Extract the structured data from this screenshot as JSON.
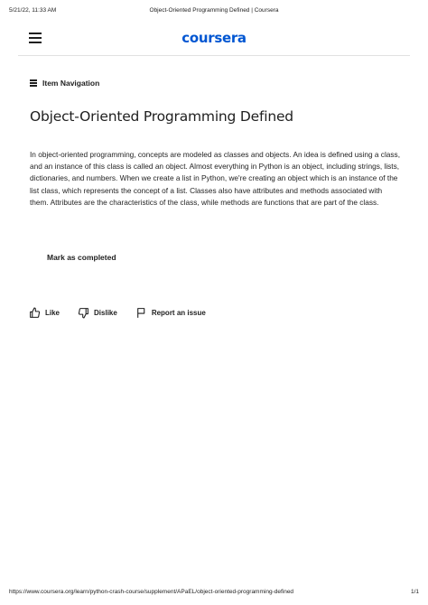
{
  "print_header": {
    "datetime": "5/21/22, 11:33 AM",
    "page_title": "Object-Oriented Programming Defined | Coursera"
  },
  "top_bar": {
    "logo_text": "coursera",
    "menu_icon": "hamburger-menu-icon",
    "brand_color": "#0056d2"
  },
  "item_navigation": {
    "icon": "list-icon",
    "label": "Item Navigation"
  },
  "article": {
    "title": "Object-Oriented Programming Defined",
    "body": "In object-oriented programming, concepts are modeled as classes and objects. An idea is defined using a class, and an instance of this class is called an object. Almost everything in Python is an object, including strings, lists, dictionaries, and numbers. When we create a list in Python, we're creating an object which is an instance of the list class, which represents the concept of a list. Classes also have attributes and methods associated with them. Attributes are the characteristics of the class, while methods are functions that are part of the class."
  },
  "actions": {
    "mark_completed": "Mark as completed"
  },
  "feedback": {
    "like": {
      "label": "Like",
      "icon": "thumbs-up-icon"
    },
    "dislike": {
      "label": "Dislike",
      "icon": "thumbs-down-icon"
    },
    "report": {
      "label": "Report an issue",
      "icon": "flag-icon"
    }
  },
  "print_footer": {
    "url": "https://www.coursera.org/learn/python-crash-course/supplement/APaEL/object-oriented-programming-defined",
    "page_number": "1/1"
  }
}
